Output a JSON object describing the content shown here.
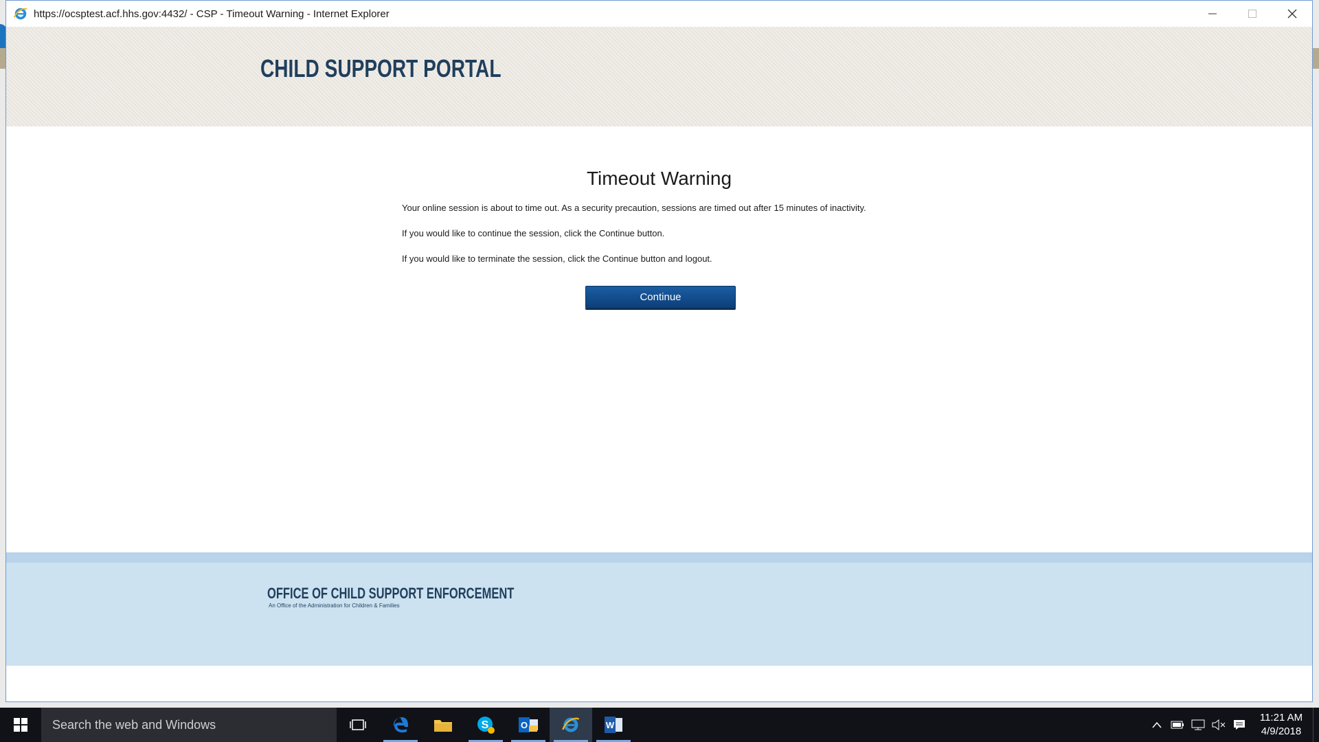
{
  "browser": {
    "window_title": "https://ocsptest.acf.hhs.gov:4432/ - CSP - Timeout Warning - Internet Explorer"
  },
  "portal": {
    "title": "CHILD SUPPORT PORTAL"
  },
  "dialog": {
    "heading": "Timeout Warning",
    "paragraphs": [
      "Your online session is about to time out. As a security precaution, sessions are timed out after 15 minutes of inactivity.",
      "If you would like to continue the session, click the Continue button.",
      "If you would like to terminate the session, click the Continue button and logout."
    ],
    "continue_label": "Continue"
  },
  "footer": {
    "org_name": "OFFICE OF CHILD SUPPORT ENFORCEMENT",
    "org_sub": "An Office of the Administration for Children & Families"
  },
  "taskbar": {
    "search_placeholder": "Search the web and Windows",
    "apps": [
      "task-view",
      "edge",
      "file-explorer",
      "skype",
      "outlook",
      "internet-explorer",
      "word"
    ],
    "time": "11:21 AM",
    "date": "4/9/2018"
  },
  "colors": {
    "brand_navy": "#1f3f5c",
    "button_blue": "#1b5ea3",
    "footer_blue": "#cde2f1",
    "header_beige": "#ece8e2"
  }
}
